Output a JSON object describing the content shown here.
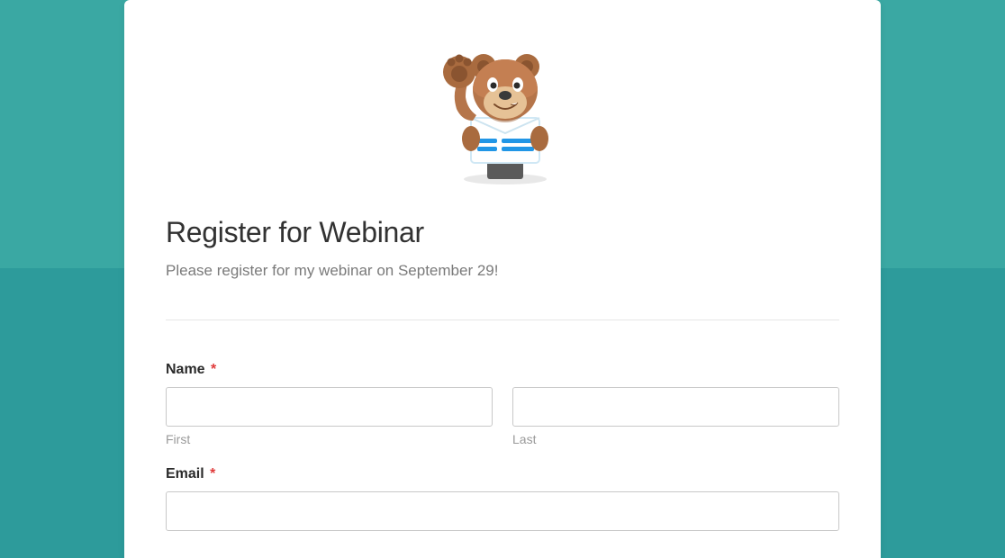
{
  "form": {
    "title": "Register for Webinar",
    "description": "Please register for my webinar on September 29!",
    "fields": {
      "name": {
        "label": "Name",
        "required_marker": "*",
        "first_sublabel": "First",
        "last_sublabel": "Last"
      },
      "email": {
        "label": "Email",
        "required_marker": "*"
      }
    }
  },
  "mascot": {
    "name": "bear-mascot-icon"
  }
}
